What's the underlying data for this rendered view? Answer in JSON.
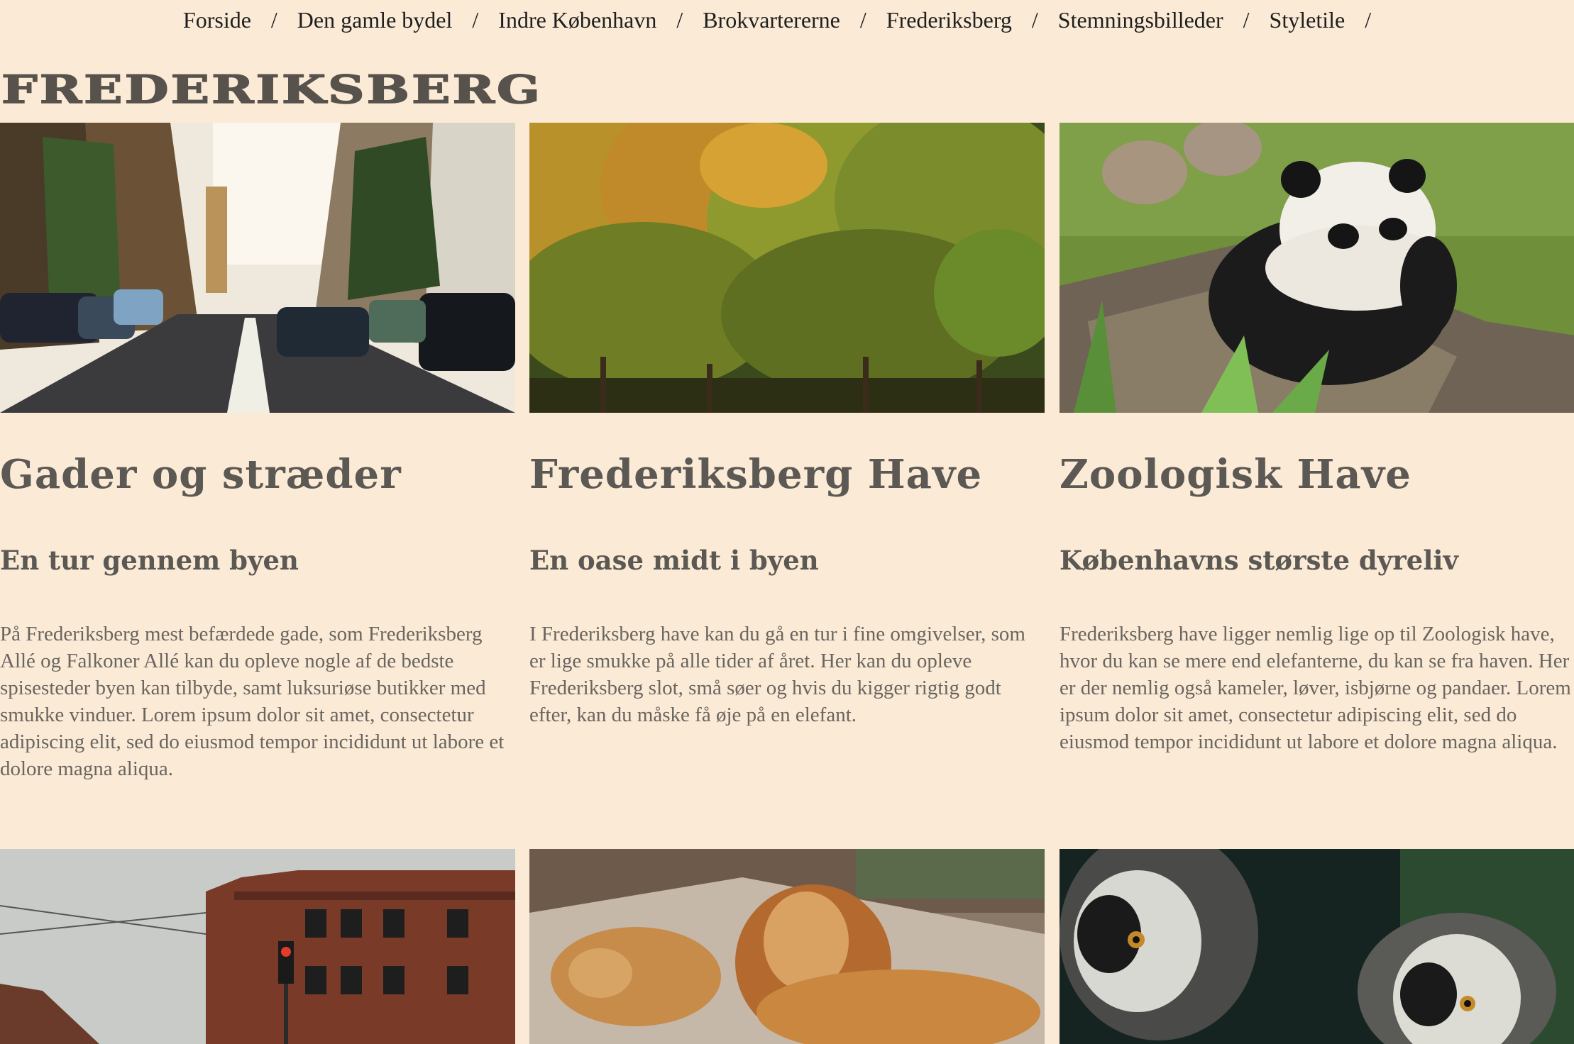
{
  "nav": {
    "items": [
      "Forside",
      "Den gamle bydel",
      "Indre København",
      "Brokvartererne",
      "Frederiksberg",
      "Stemningsbilleder",
      "Styletile"
    ],
    "separator": "/"
  },
  "page": {
    "title": "FREDERIKSBERG"
  },
  "cards": [
    {
      "title": "Gader og stræder",
      "subtitle": "En tur gennem byen",
      "body": "På Frederiksberg mest befærdede gade, som Frederiksberg Allé og Falkoner Allé kan du opleve nogle af de bedste spisesteder byen kan tilbyde, samt luksuriøse butikker med smukke vinduer. Lorem ipsum dolor sit amet, consectetur adipiscing elit, sed do eiusmod tempor incididunt ut labore et dolore magna aliqua."
    },
    {
      "title": "Frederiksberg Have",
      "subtitle": "En oase midt i byen",
      "body": "I Frederiksberg have kan du gå en tur i fine omgivelser, som er lige smukke på alle tider af året. Her kan du opleve Frederiksberg slot, små søer og hvis du kigger rigtig godt efter, kan du måske få øje på en elefant."
    },
    {
      "title": "Zoologisk Have",
      "subtitle": "Københavns største dyreliv",
      "body": "Frederiksberg have ligger nemlig lige op til Zoologisk have, hvor du kan se mere end elefanterne, du kan se fra haven. Her er der nemlig også kameler, løver, isbjørne og pandaer. Lorem ipsum dolor sit amet, consectetur adipiscing elit, sed do eiusmod tempor incididunt ut labore et dolore magna aliqua."
    }
  ],
  "colors": {
    "background": "#fbebd6",
    "heading": "#5c5854",
    "body_text": "#6a6560",
    "nav_text": "#1f1f1f"
  }
}
